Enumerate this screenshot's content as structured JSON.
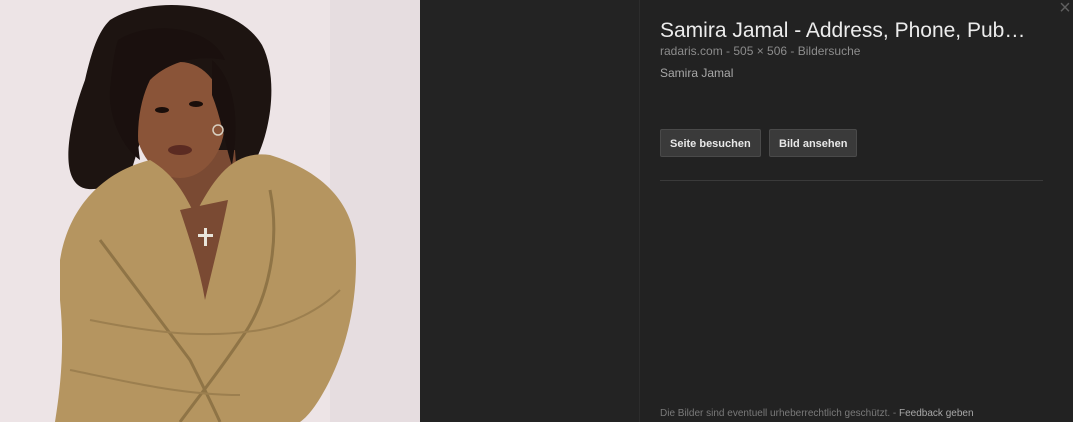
{
  "result": {
    "title": "Samira Jamal - Address, Phone, Pub…",
    "source": "radaris.com",
    "separator1": " - ",
    "dimensions": "505 × 506",
    "separator2": " - ",
    "search_link": "Bildersuche",
    "description": "Samira Jamal"
  },
  "buttons": {
    "visit_page": "Seite besuchen",
    "view_image": "Bild ansehen"
  },
  "footer": {
    "copyright_notice": "Die Bilder sind eventuell urheberrechtlich geschützt.",
    "separator": " - ",
    "feedback": "Feedback geben"
  },
  "icons": {
    "close": "close-icon"
  },
  "colors": {
    "background": "#222222",
    "title": "#ececec",
    "muted": "#8c8c8c",
    "button_bg": "#3a3a3a"
  }
}
